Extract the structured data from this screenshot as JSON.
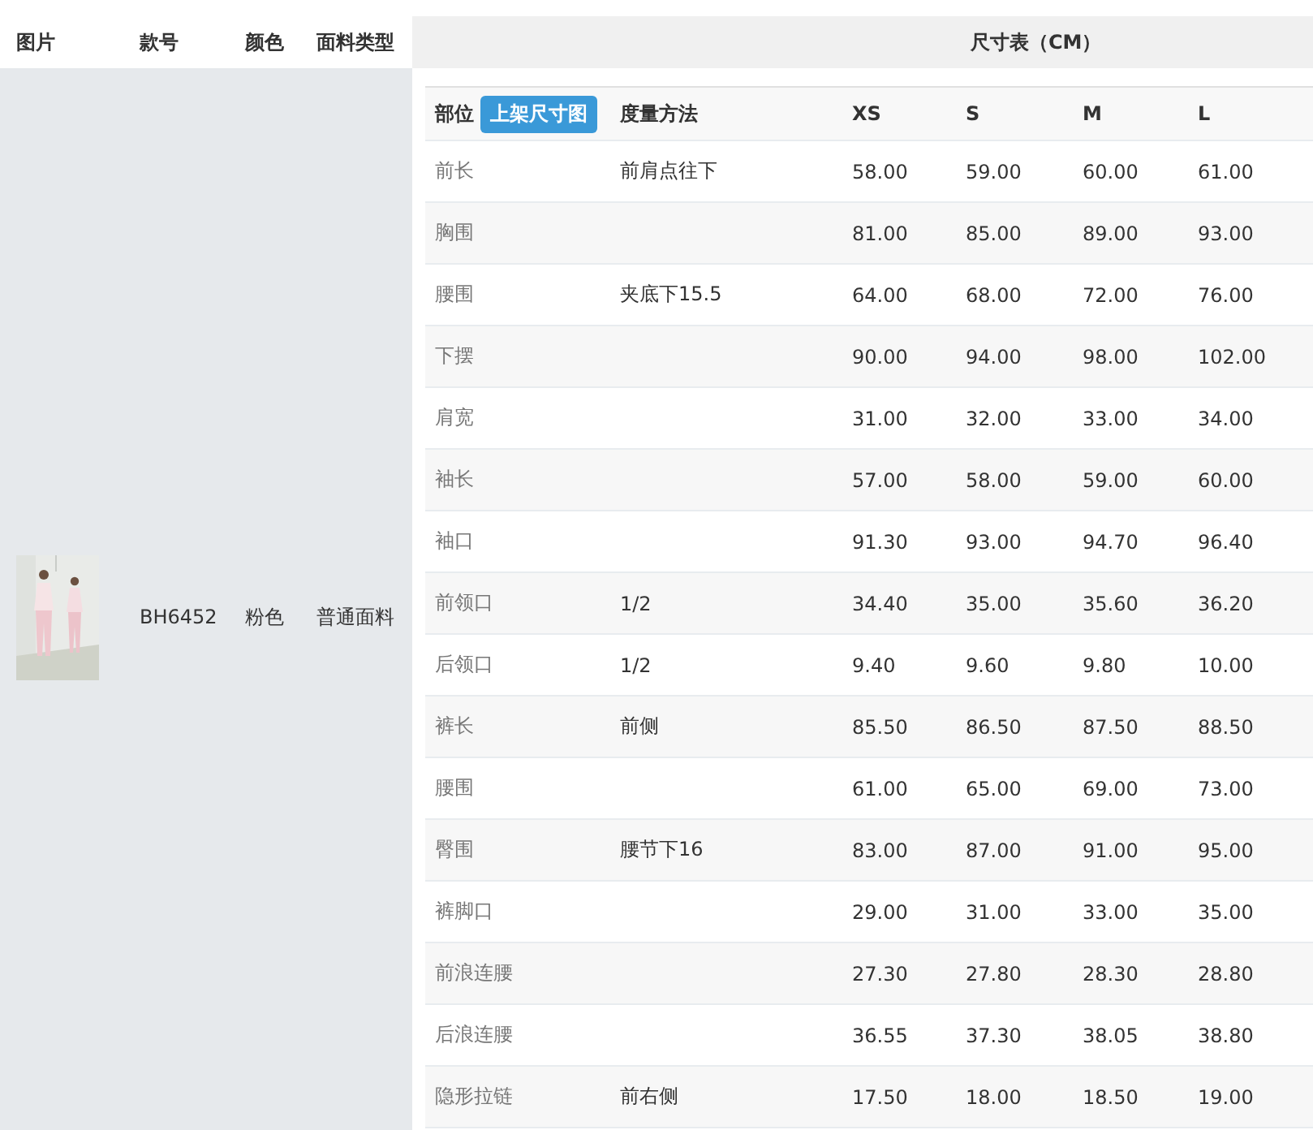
{
  "product_table": {
    "columns": [
      "图片",
      "款号",
      "颜色",
      "面料类型"
    ],
    "row": {
      "style_no": "BH6452",
      "colour_label": "粉色",
      "fabric": "普通面料"
    }
  },
  "size_chart": {
    "title": "尺寸表（CM）",
    "columns": {
      "part": "部位",
      "button": "上架尺寸图",
      "method": "度量方法",
      "sizes": [
        "XS",
        "S",
        "M",
        "L"
      ]
    },
    "rows": [
      {
        "part": "前长",
        "method": "前肩点往下",
        "values": [
          "58.00",
          "59.00",
          "60.00",
          "61.00"
        ]
      },
      {
        "part": "胸围",
        "values": [
          "81.00",
          "85.00",
          "89.00",
          "93.00"
        ]
      },
      {
        "part": "腰围",
        "method": "夹底下15.5",
        "values": [
          "64.00",
          "68.00",
          "72.00",
          "76.00"
        ]
      },
      {
        "part": "下摆",
        "values": [
          "90.00",
          "94.00",
          "98.00",
          "102.00"
        ]
      },
      {
        "part": "肩宽",
        "values": [
          "31.00",
          "32.00",
          "33.00",
          "34.00"
        ]
      },
      {
        "part": "袖长",
        "values": [
          "57.00",
          "58.00",
          "59.00",
          "60.00"
        ]
      },
      {
        "part": "袖口",
        "values": [
          "91.30",
          "93.00",
          "94.70",
          "96.40"
        ]
      },
      {
        "part": "前领口",
        "method": "1/2",
        "values": [
          "34.40",
          "35.00",
          "35.60",
          "36.20"
        ]
      },
      {
        "part": "后领口",
        "method": "1/2",
        "values": [
          "9.40",
          "9.60",
          "9.80",
          "10.00"
        ]
      },
      {
        "part": "裤长",
        "method": "前侧",
        "values": [
          "85.50",
          "86.50",
          "87.50",
          "88.50"
        ]
      },
      {
        "part": "腰围",
        "values": [
          "61.00",
          "65.00",
          "69.00",
          "73.00"
        ]
      },
      {
        "part": "臀围",
        "method": "腰节下16",
        "values": [
          "83.00",
          "87.00",
          "91.00",
          "95.00"
        ]
      },
      {
        "part": "裤脚口",
        "values": [
          "29.00",
          "31.00",
          "33.00",
          "35.00"
        ]
      },
      {
        "part": "前浪连腰",
        "values": [
          "27.30",
          "27.80",
          "28.30",
          "28.80"
        ]
      },
      {
        "part": "后浪连腰",
        "values": [
          "36.55",
          "37.30",
          "38.05",
          "38.80"
        ]
      },
      {
        "part": "隐形拉链",
        "method": "前右侧",
        "values": [
          "17.50",
          "18.00",
          "18.50",
          "19.00"
        ]
      }
    ]
  }
}
